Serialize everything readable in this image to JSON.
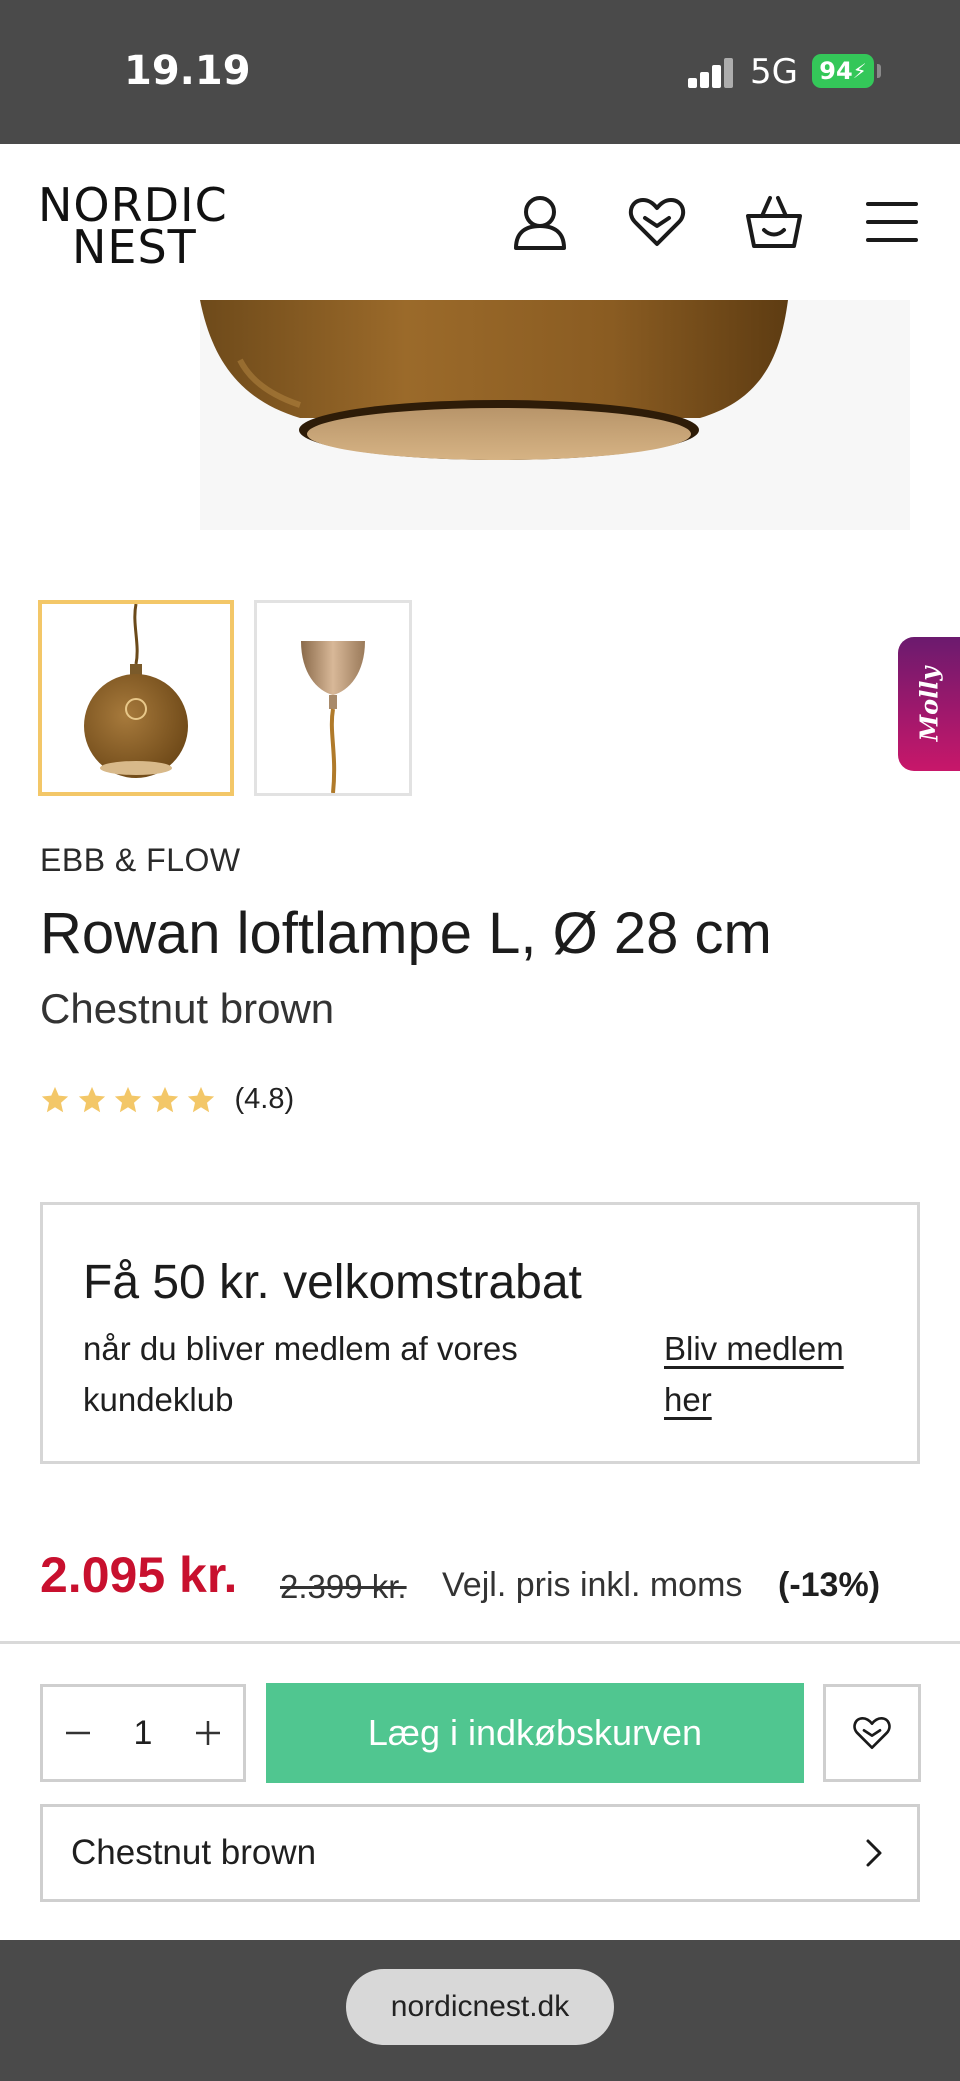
{
  "status_bar": {
    "time": "19.19",
    "network": "5G",
    "battery": "94"
  },
  "header": {
    "logo_line1": "NORDIC",
    "logo_line2": "NEST",
    "icons": [
      "account-icon",
      "wishlist-icon",
      "basket-icon",
      "menu-icon"
    ]
  },
  "gallery": {
    "thumbnails": [
      "pendant-globe-thumbnail",
      "ceiling-cup-thumbnail"
    ],
    "selected_index": 0
  },
  "chat_widget": {
    "label": "Molly"
  },
  "product": {
    "brand": "EBB & FLOW",
    "title": "Rowan loftlampe L, Ø 28 cm",
    "variant": "Chestnut brown",
    "rating_stars": 5,
    "rating_text": "(4.8)"
  },
  "promo": {
    "title": "Få 50 kr. velkomstrabat",
    "description": "når du bliver medlem af vores kundeklub",
    "link": "Bliv medlem her"
  },
  "pricing": {
    "price": "2.095 kr.",
    "old_price": "2.399 kr.",
    "rrp_label": "Vejl. pris inkl. moms",
    "discount": "(-13%)"
  },
  "cart": {
    "quantity": "1",
    "add_label": "Læg i indkøbskurven",
    "variant_select": "Chestnut brown"
  },
  "browser": {
    "url": "nordicnest.dk"
  },
  "colors": {
    "accent_green": "#50c690",
    "sale_red": "#c8102e",
    "star_yellow": "#f3c768",
    "thumb_selected": "#f3c768",
    "chrome_gray": "#4a4a4a"
  }
}
